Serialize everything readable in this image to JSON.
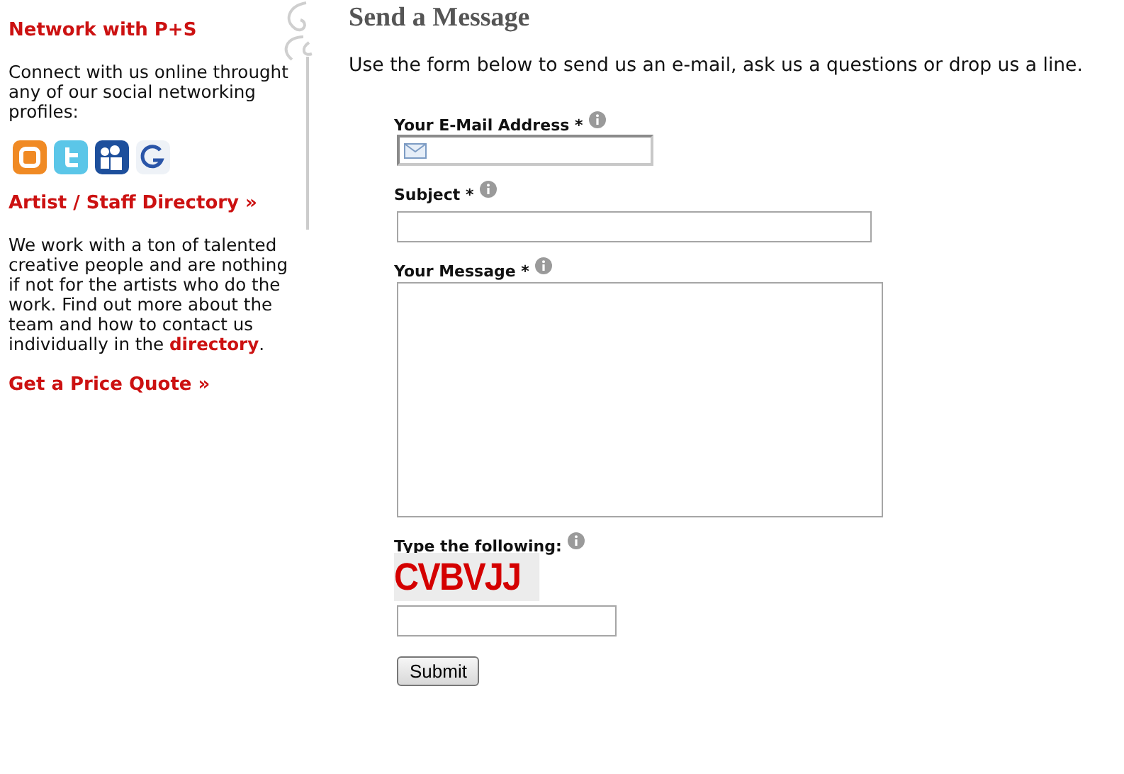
{
  "sidebar": {
    "network_heading": "Network with P+S",
    "network_text": "Connect with us online throught any of our social networking profiles:",
    "social_icons": [
      {
        "kind": "blogger"
      },
      {
        "kind": "twitter"
      },
      {
        "kind": "myspace"
      },
      {
        "kind": "google"
      }
    ],
    "directory_heading": "Artist / Staff Directory »",
    "directory_text": "We work with a ton of talented creative people and are nothing if not for the artists who do the work. Find out more about the team and how to contact us individually in the ",
    "directory_link": "directory",
    "directory_end": ".",
    "quote_link": "Get a Price Quote »"
  },
  "main": {
    "title": "Send a Message",
    "intro": "Use the form below to send us an e-mail, ask us a questions or drop us a line.",
    "fields": [
      {
        "kind": "email",
        "label": "Your E-Mail Address",
        "required": "*"
      },
      {
        "kind": "text",
        "label": "Subject",
        "required": "*"
      },
      {
        "kind": "textarea",
        "label": "Your Message",
        "required": "*"
      },
      {
        "kind": "captcha",
        "label": "Type the following:",
        "captcha": "CVBVJJ"
      }
    ],
    "submit": "Submit"
  }
}
